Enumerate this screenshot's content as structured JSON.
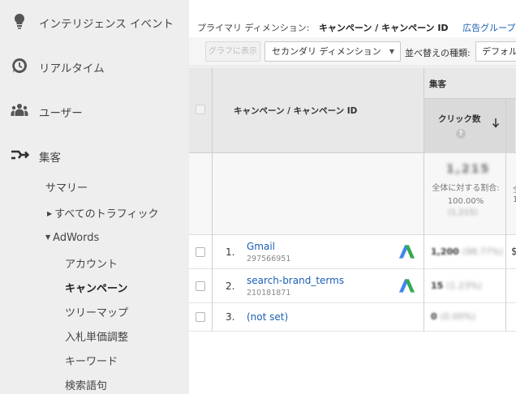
{
  "sidebar": {
    "main_items": [
      {
        "label": "インテリジェンス イベント",
        "icon": "lightbulb-icon"
      },
      {
        "label": "リアルタイム",
        "icon": "clock-icon"
      },
      {
        "label": "ユーザー",
        "icon": "users-icon"
      },
      {
        "label": "集客",
        "icon": "acquisition-icon"
      }
    ],
    "acquisition_sub": [
      {
        "label": "サマリー"
      },
      {
        "label": "すべてのトラフィック",
        "expander": "▶"
      },
      {
        "label": "AdWords",
        "expander": "▼"
      }
    ],
    "adwords_sub": [
      {
        "label": "アカウント"
      },
      {
        "label": "キャンペーン",
        "active": true
      },
      {
        "label": "ツリーマップ"
      },
      {
        "label": "入札単価調整"
      },
      {
        "label": "キーワード"
      },
      {
        "label": "検索語句"
      }
    ]
  },
  "dimension_bar": {
    "label": "プライマリ ディメンション:",
    "selected": "キャンペーン / キャンペーン ID",
    "link": "広告グループ"
  },
  "toolbar": {
    "plot_button": "グラフに表示",
    "secondary_dimension": "セカンダリ ディメンション",
    "sort_label": "並べ替えの種類:",
    "sort_value": "デフォルト"
  },
  "table": {
    "header": {
      "dimension": "キャンペーン / キャンペーン ID",
      "group": "集客",
      "metric": "クリック数",
      "help": "?"
    },
    "totals": {
      "value": "1,215",
      "pct_label": "全体に対する割合: 100.00%",
      "sub_value": "(1,215)",
      "next_col_edge_1": "全",
      "next_col_edge_2": "1"
    },
    "rows": [
      {
        "num": "1.",
        "campaign": "Gmail",
        "id": "297566951",
        "value": "1,200",
        "pct": "(98.77%)",
        "edge": "$"
      },
      {
        "num": "2.",
        "campaign": "search-brand_terms",
        "id": "210181871",
        "value": "15",
        "pct": "(1.23%)",
        "edge": ""
      },
      {
        "num": "3.",
        "campaign": "(not set)",
        "id": "",
        "value": "0",
        "pct": "(0.00%)",
        "edge": ""
      }
    ]
  },
  "colors": {
    "sidebar_bg": "#eeeeee",
    "link_blue": "#1a5fb4",
    "header_bg": "#e8e8e8",
    "adwords_blue": "#4285f4",
    "adwords_green": "#34a853"
  }
}
